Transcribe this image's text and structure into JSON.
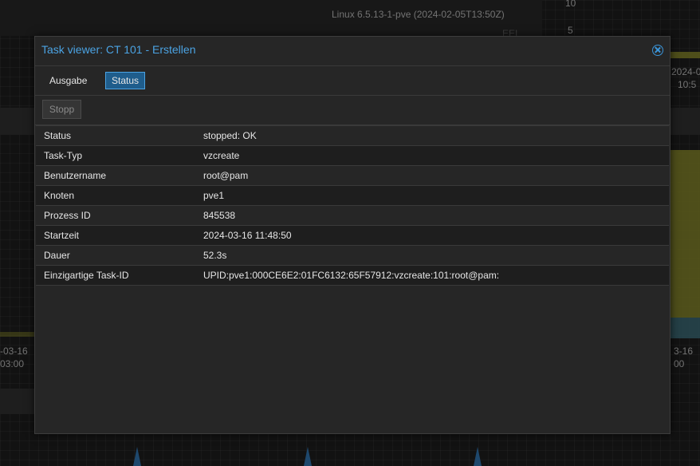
{
  "background": {
    "kernel_text": "Linux 6.5.13-1-pve (2024-02-05T13:50Z)",
    "axis_top": "10",
    "axis_five": "5",
    "ee_text": "EEI",
    "date_right_top": "2024-0",
    "time_right_top": "10:5",
    "date_left": "-03-16",
    "time_left": "03:00",
    "date_right_bottom": "3-16",
    "time_right_bottom": "00"
  },
  "window": {
    "title": "Task viewer: CT 101 - Erstellen"
  },
  "tabs": [
    {
      "label": "Ausgabe",
      "active": false
    },
    {
      "label": "Status",
      "active": true
    }
  ],
  "toolbar": {
    "stop_label": "Stopp"
  },
  "details": [
    {
      "key": "Status",
      "value": "stopped: OK"
    },
    {
      "key": "Task-Typ",
      "value": "vzcreate"
    },
    {
      "key": "Benutzername",
      "value": "root@pam"
    },
    {
      "key": "Knoten",
      "value": "pve1"
    },
    {
      "key": "Prozess ID",
      "value": "845538"
    },
    {
      "key": "Startzeit",
      "value": "2024-03-16 11:48:50"
    },
    {
      "key": "Dauer",
      "value": "52.3s"
    },
    {
      "key": "Einzigartige Task-ID",
      "value": "UPID:pve1:000CE6E2:01FC6132:65F57912:vzcreate:101:root@pam:"
    }
  ],
  "colors": {
    "accent": "#4ba3e3",
    "active_tab_bg": "#1f5d8c"
  }
}
